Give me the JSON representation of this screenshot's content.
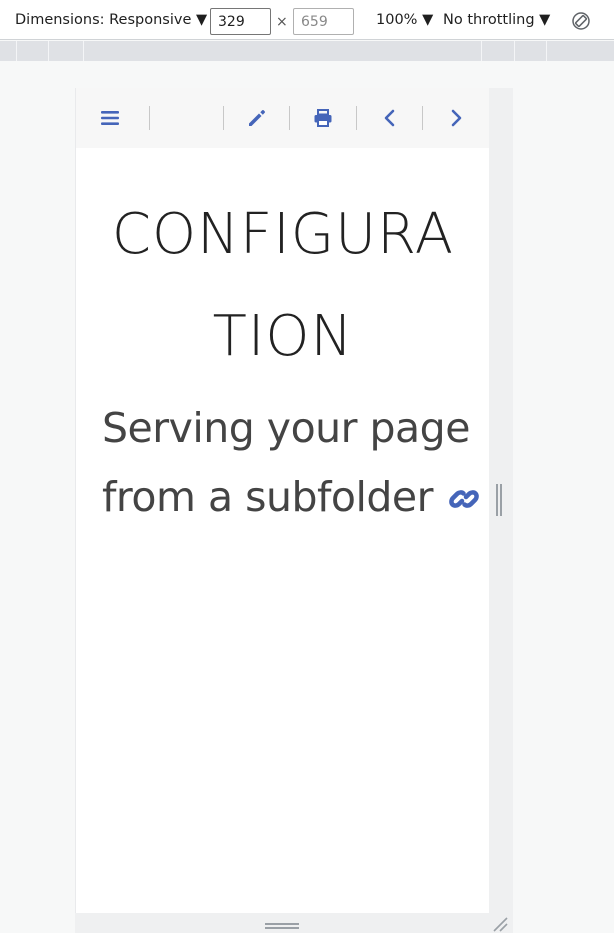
{
  "devtools": {
    "dimensions_label": "Dimensions: Responsive ▼",
    "width_value": "329",
    "height_value": "659",
    "times": "×",
    "zoom": "100% ▼",
    "throttling": "No throttling ▼",
    "rotate_icon": "rotate-icon"
  },
  "page": {
    "title_line1": "CONFIGURA",
    "title_line2": "TION",
    "heading_line1": "Serving your page",
    "heading_line2": "from a subfolder",
    "accent_color": "#4565b9",
    "toolbar_icons": [
      "menu-icon",
      "edit-icon",
      "print-icon",
      "chevron-left-icon",
      "chevron-right-icon"
    ]
  }
}
